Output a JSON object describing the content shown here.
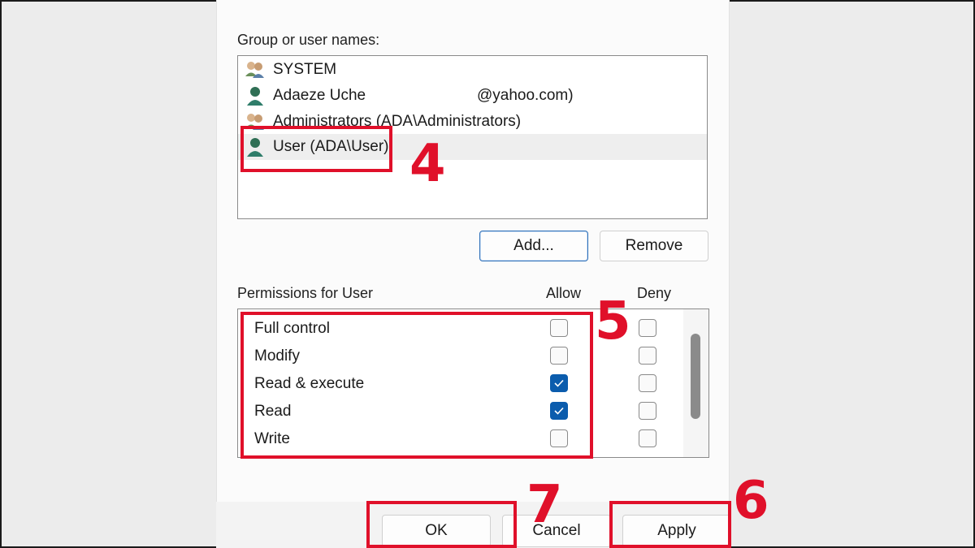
{
  "dialog": {
    "group_label": "Group or user names:",
    "users": [
      {
        "name": "SYSTEM",
        "icon": "group-users-icon"
      },
      {
        "name": "Adaeze Uche",
        "email": "@yahoo.com)",
        "icon": "user-icon"
      },
      {
        "name": "Administrators (ADA\\Administrators)",
        "icon": "group-users-icon"
      },
      {
        "name": "User (ADA\\User)",
        "icon": "user-icon",
        "selected": true
      }
    ],
    "add_label": "Add...",
    "remove_label": "Remove",
    "permissions_label": "Permissions for User",
    "allow_label": "Allow",
    "deny_label": "Deny",
    "permissions": [
      {
        "name": "Full control",
        "allow": false,
        "deny": false
      },
      {
        "name": "Modify",
        "allow": false,
        "deny": false
      },
      {
        "name": "Read & execute",
        "allow": true,
        "deny": false
      },
      {
        "name": "Read",
        "allow": true,
        "deny": false
      },
      {
        "name": "Write",
        "allow": false,
        "deny": false
      }
    ],
    "ok_label": "OK",
    "cancel_label": "Cancel",
    "apply_label": "Apply"
  },
  "annotations": {
    "step_users": "4",
    "step_permissions": "5",
    "step_apply": "6",
    "step_ok": "7"
  },
  "colors": {
    "annotation_red": "#e0102a",
    "checkbox_blue": "#0b5cad"
  }
}
